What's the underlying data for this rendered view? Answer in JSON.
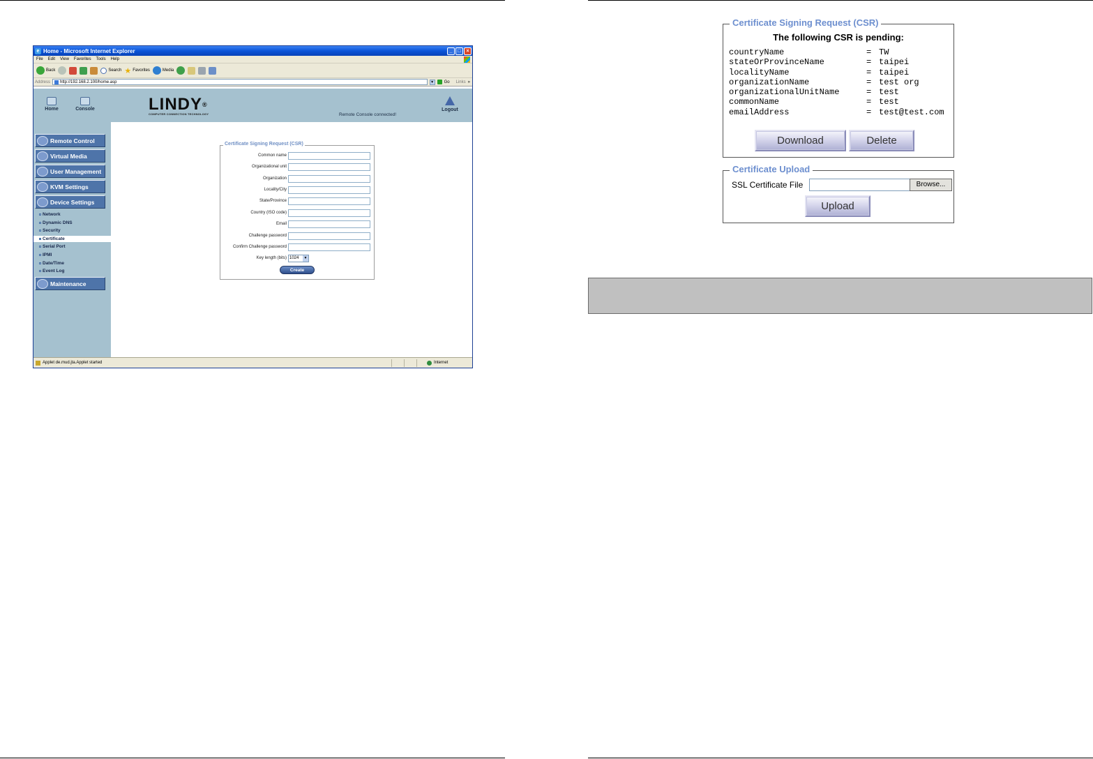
{
  "ie": {
    "title": "Home - Microsoft Internet Explorer",
    "menu": [
      "File",
      "Edit",
      "View",
      "Favorites",
      "Tools",
      "Help"
    ],
    "toolbar": {
      "back": "Back",
      "search": "Search",
      "favorites": "Favorites",
      "media": "Media"
    },
    "address_label": "Address",
    "address_url": "http://192.168.2.100/home.asp",
    "go_label": "Go",
    "links_label": "Links",
    "status_text": "Applet de.mud.jta.Applet started",
    "zone": "Internet"
  },
  "lindy": {
    "header": {
      "home": "Home",
      "console": "Console",
      "logout": "Logout",
      "status": "Remote Console connected!"
    },
    "logo": {
      "wordmark": "LINDY",
      "tagline": "COMPUTER CONNECTION TECHNOLOGY"
    },
    "sidebar": {
      "sections": [
        "Remote Control",
        "Virtual Media",
        "User Management",
        "KVM Settings",
        "Device Settings"
      ],
      "subitems": [
        "Network",
        "Dynamic DNS",
        "Security",
        "Certificate",
        "Serial Port",
        "IPMI",
        "Date/Time",
        "Event Log"
      ],
      "maintenance": "Maintenance"
    },
    "csr_form": {
      "legend": "Certificate Signing Request (CSR)",
      "fields": [
        "Common name",
        "Organizational unit",
        "Organization",
        "Locality/City",
        "State/Province",
        "Country (ISO code)",
        "Email",
        "Challenge password",
        "Confirm Challenge password"
      ],
      "keylen_label": "Key length (bits)",
      "keylen_value": "1024",
      "create_button": "Create"
    }
  },
  "csr_panel": {
    "legend": "Certificate Signing Request (CSR)",
    "pending_text": "The following CSR is pending:",
    "entries": [
      {
        "key": "countryName",
        "value": "TW"
      },
      {
        "key": "stateOrProvinceName",
        "value": "taipei"
      },
      {
        "key": "localityName",
        "value": "taipei"
      },
      {
        "key": "organizationName",
        "value": "test org"
      },
      {
        "key": "organizationalUnitName",
        "value": "test"
      },
      {
        "key": "commonName",
        "value": "test"
      },
      {
        "key": "emailAddress",
        "value": "test@test.com"
      }
    ],
    "separator": "=",
    "download_button": "Download",
    "delete_button": "Delete"
  },
  "upload_panel": {
    "legend": "Certificate Upload",
    "file_label": "SSL Certificate File",
    "browse_button": "Browse...",
    "upload_button": "Upload"
  },
  "colors": {
    "legend_blue": "#6d8fcf",
    "lindy_panel": "#a5c1cf",
    "note_gray": "#c0c0c0"
  }
}
